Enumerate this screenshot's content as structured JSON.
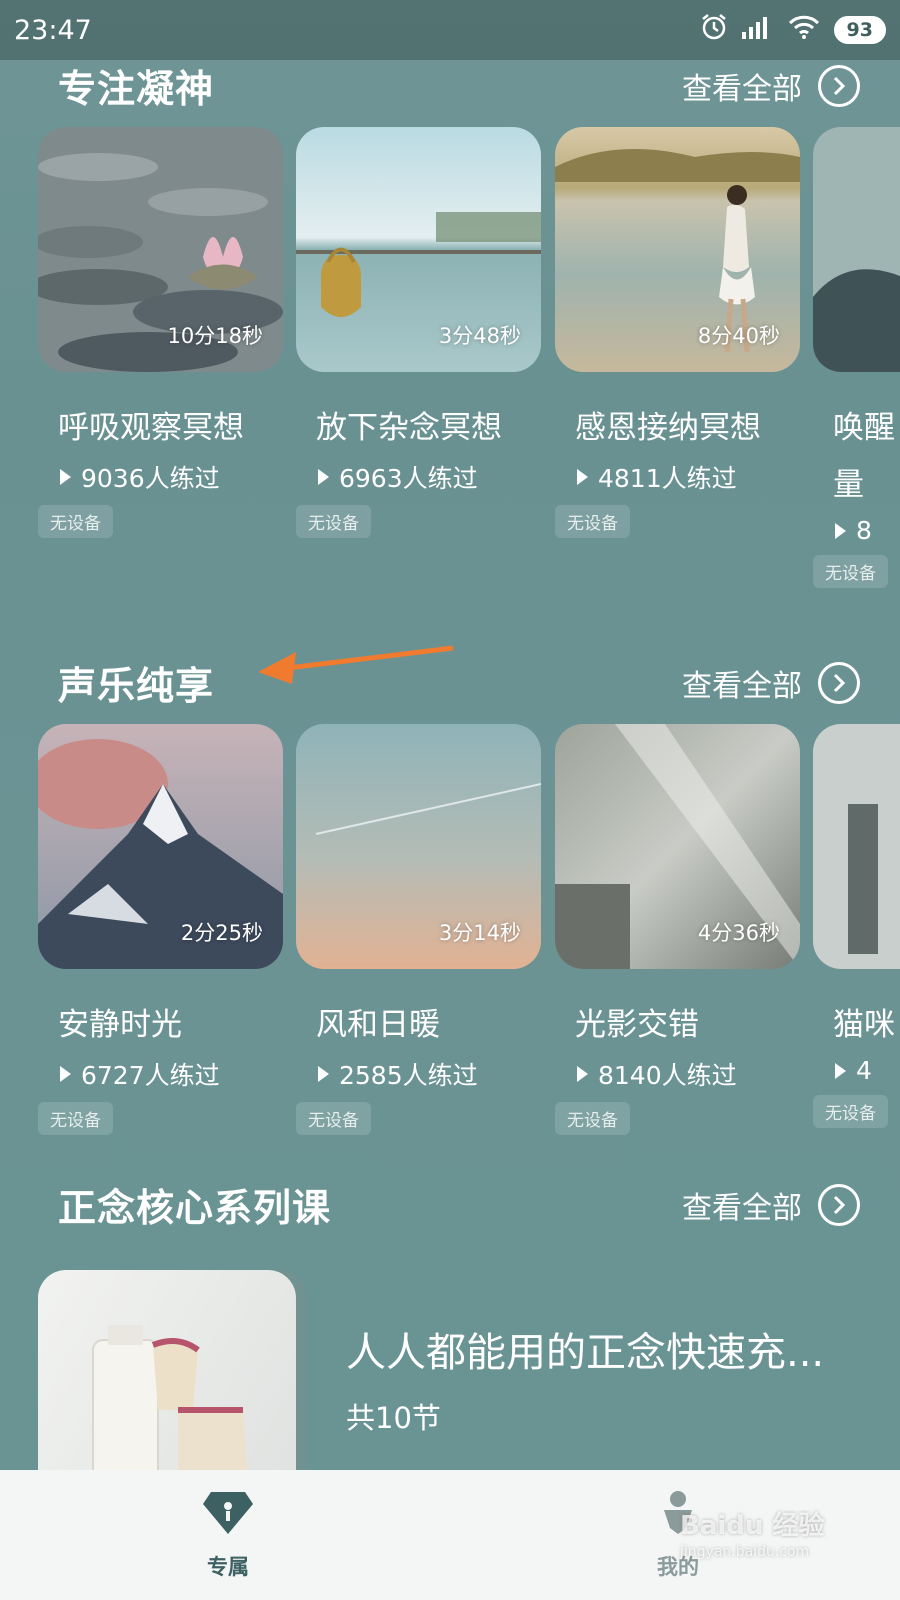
{
  "status_bar": {
    "time": "23:47",
    "battery": "93"
  },
  "sections": [
    {
      "title": "专注凝神",
      "see_all": "查看全部",
      "cards": [
        {
          "title": "呼吸观察冥想",
          "duration": "10分18秒",
          "count": "9036人练过",
          "tag": "无设备"
        },
        {
          "title": "放下杂念冥想",
          "duration": "3分48秒",
          "count": "6963人练过",
          "tag": "无设备"
        },
        {
          "title": "感恩接纳冥想",
          "duration": "8分40秒",
          "count": "4811人练过",
          "tag": "无设备"
        },
        {
          "title": "唤醒",
          "title_line2": "量",
          "count": "8",
          "tag": "无设备"
        }
      ]
    },
    {
      "title": "声乐纯享",
      "see_all": "查看全部",
      "cards": [
        {
          "title": "安静时光",
          "duration": "2分25秒",
          "count": "6727人练过",
          "tag": "无设备"
        },
        {
          "title": "风和日暖",
          "duration": "3分14秒",
          "count": "2585人练过",
          "tag": "无设备"
        },
        {
          "title": "光影交错",
          "duration": "4分36秒",
          "count": "8140人练过",
          "tag": "无设备"
        },
        {
          "title": "猫咪",
          "count": "4",
          "tag": "无设备"
        }
      ]
    },
    {
      "title": "正念核心系列课",
      "see_all": "查看全部"
    }
  ],
  "course": {
    "title": "人人都能用的正念快速充...",
    "lessons": "共10节"
  },
  "tabs": [
    {
      "label": "专属",
      "icon": "diamond-icon",
      "active": true
    },
    {
      "label": "我的",
      "icon": "person-icon",
      "active": false
    }
  ],
  "watermark": {
    "brand": "Baidu 经验",
    "url": "jingyan.baidu.com"
  },
  "colors": {
    "background": "#6b9394",
    "arrow": "#f07a2e",
    "tab_active": "#3d6062"
  }
}
